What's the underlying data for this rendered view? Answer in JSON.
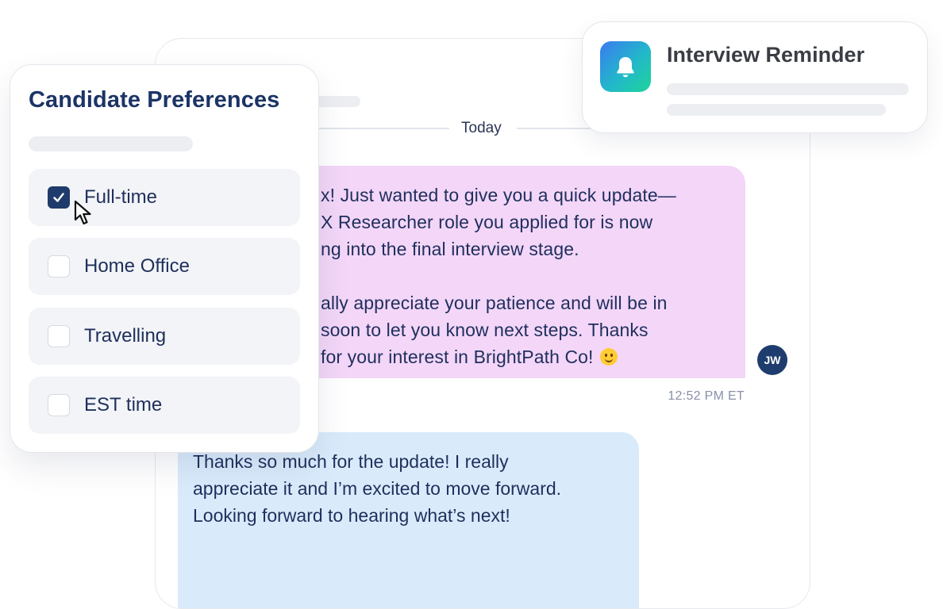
{
  "chat": {
    "date_divider": "Today",
    "recruiter_message": {
      "paragraph1": "x! Just wanted to give you a quick update—\nX Researcher role you applied for is now\nng into the final interview stage.",
      "paragraph2": "ally appreciate your patience and will be in\nsoon to let you know next steps. Thanks\nfor your interest in BrightPath Co!",
      "emoji": "smiling-face"
    },
    "avatar_initials": "JW",
    "timestamp": "12:52 PM ET",
    "candidate_message": "Thanks so much for the update! I really\nappreciate it and I’m excited to move forward.\nLooking forward to hearing what’s next!",
    "colors": {
      "recruiter_bubble": "#f3d6f8",
      "candidate_bubble": "#d9ebfb",
      "avatar": "#1e3d6e"
    }
  },
  "preferences": {
    "title": "Candidate Preferences",
    "options": [
      {
        "label": "Full-time",
        "checked": true
      },
      {
        "label": "Home Office",
        "checked": false
      },
      {
        "label": "Travelling",
        "checked": false
      },
      {
        "label": "EST time",
        "checked": false
      }
    ],
    "check_color": "#1f3b6b"
  },
  "reminder": {
    "title": "Interview Reminder",
    "icon": "bell-icon"
  }
}
